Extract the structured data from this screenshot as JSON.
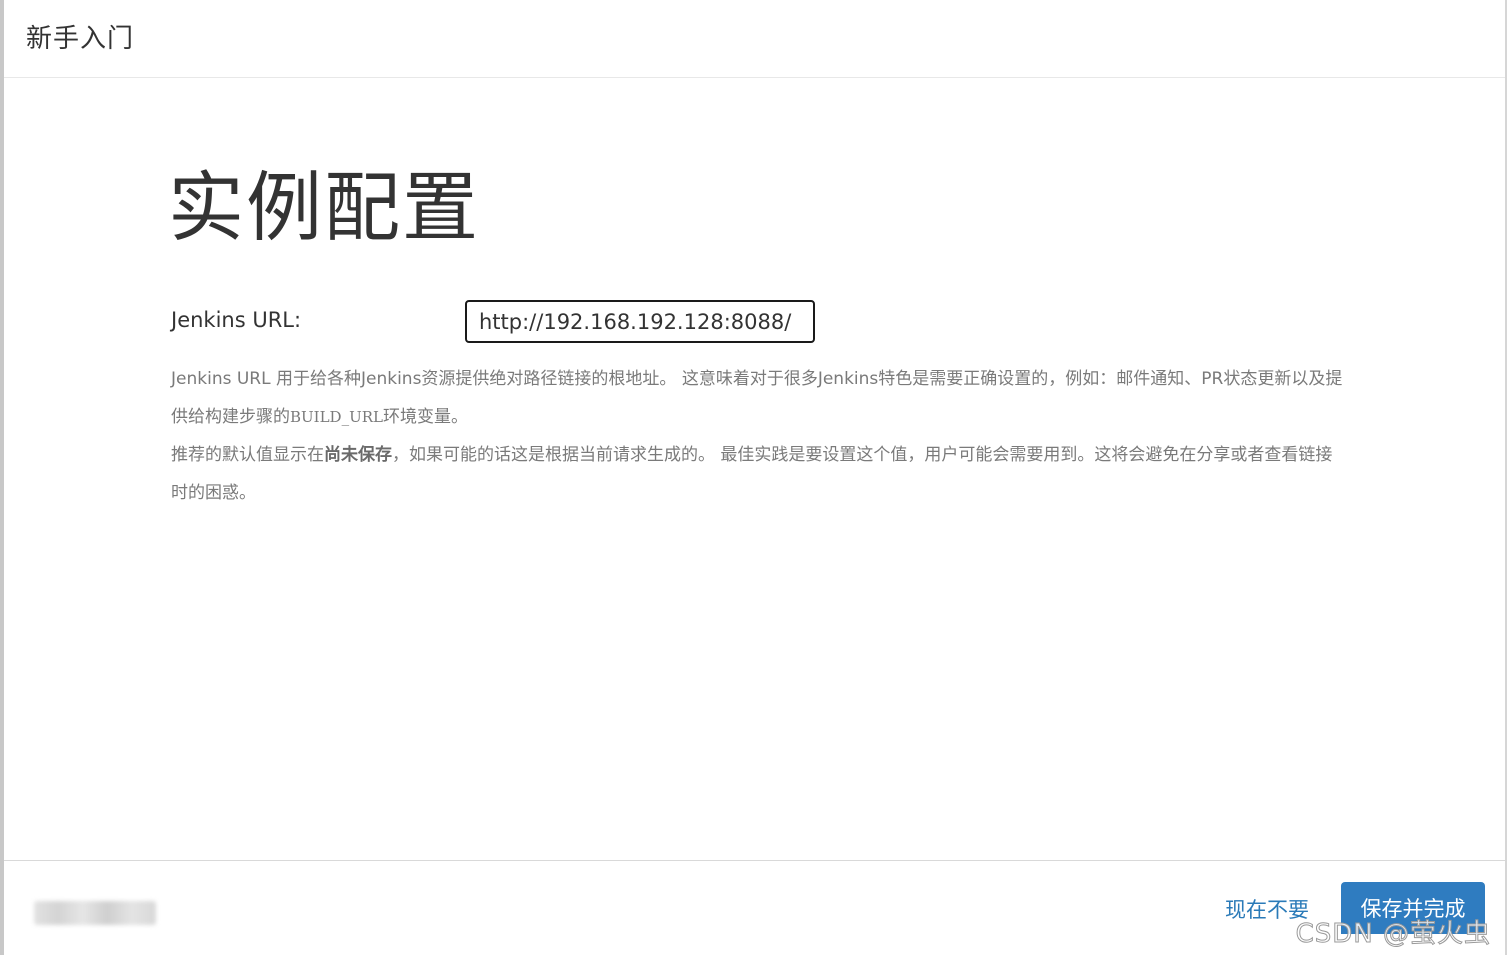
{
  "header": {
    "title": "新手入门"
  },
  "main": {
    "title": "实例配置",
    "url_label": "Jenkins URL:",
    "url_value": "http://192.168.192.128:8088/",
    "help": {
      "line1_a": "Jenkins URL 用于给各种Jenkins资源提供绝对路径链接的根地址。 这意味着对于很多Jenkins特色是需要正确设置的，例如：邮件通知、PR状态更新以及提供给构建步骤的",
      "line1_code": "BUILD_URL",
      "line1_b": "环境变量。",
      "line2_a": "推荐的默认值显示在",
      "line2_strong": "尚未保存",
      "line2_b": "，如果可能的话这是根据当前请求生成的。 最佳实践是要设置这个值，用户可能会需要用到。这将会避免在分享或者查看链接时的困惑。"
    }
  },
  "footer": {
    "skip_label": "现在不要",
    "save_label": "保存并完成",
    "watermark": "CSDN @萤火虫"
  },
  "colors": {
    "primary_button": "#2f7cc0",
    "link": "#2a7ab8",
    "help_text": "#7a7a7a"
  }
}
